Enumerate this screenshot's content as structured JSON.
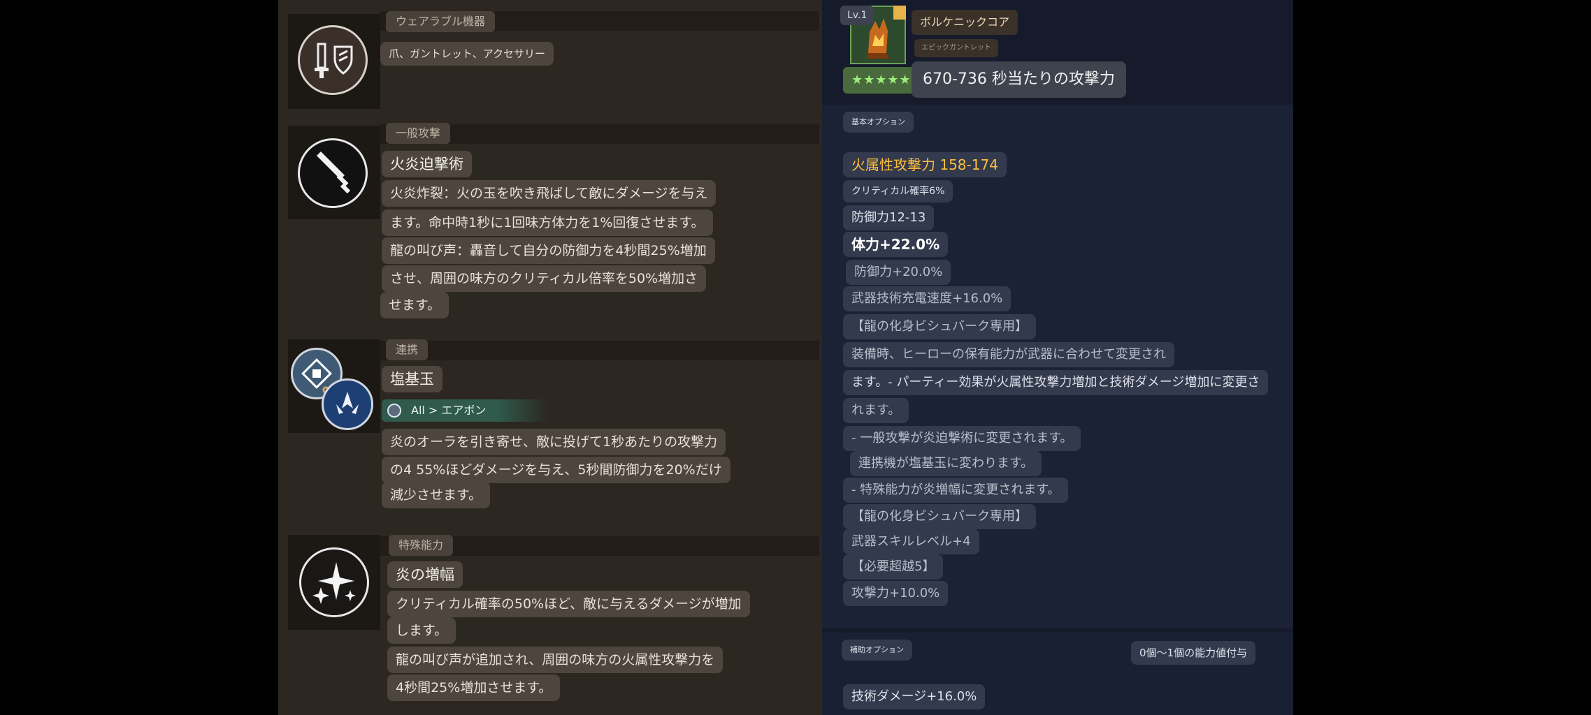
{
  "left": {
    "wearable": {
      "category": "ウェアラブル機器",
      "items": "爪、ガントレット、アクセサリー",
      "icon": "sword-shield-icon"
    },
    "normal_attack": {
      "category": "一般攻撃",
      "name": "火炎迫撃術",
      "icon": "dagger-icon",
      "desc_lines": [
        "火炎炸裂：火の玉を吹き飛ばして敵にダメージを与え",
        "ます。命中時1秒に1回味方体力を1%回復させます。",
        "龍の叫び声：轟音して自分の防御力を4秒間25%増加",
        "させ、周囲の味方のクリティカル倍率を50%増加さ",
        "せます。"
      ]
    },
    "chain": {
      "category": "連携",
      "name": "塩基玉",
      "tag": "All > エアボン",
      "icons": [
        "chain-rune-icon",
        "link-icon",
        "air-emblem-icon"
      ],
      "desc_lines": [
        "炎のオーラを引き寄せ、敵に投げて1秒あたりの攻撃力",
        "の4 55%ほどダメージを与え、5秒間防御力を20%だけ",
        "減少させます。"
      ]
    },
    "special": {
      "category": "特殊能力",
      "name": "炎の増幅",
      "icon": "sparkle-icon",
      "desc_lines": [
        "クリティカル確率の50%ほど、敵に与えるダメージが増加",
        "します。",
        "龍の叫び声が追加され、周囲の味方の火属性攻撃力を",
        "4秒間25%増加させます。"
      ]
    }
  },
  "right": {
    "item": {
      "level": "Lv.1",
      "name": "ボルケニックコア",
      "subtitle": "エピックガントレット",
      "stars": "★★★★★",
      "attack": "670-736 秒当たりの攻撃力",
      "icon": "volcanic-core-gauntlet-icon"
    },
    "base_options": {
      "header": "基本オプション",
      "lines": [
        {
          "text": "火属性攻撃力 158-174",
          "style": "gold"
        },
        {
          "text": "クリティカル確率6%",
          "style": "tiny"
        },
        {
          "text": "防御力12-13",
          "style": ""
        },
        {
          "text": "体力+22.0%",
          "style": "bold"
        },
        {
          "text": "防御力+20.0%",
          "style": "dim"
        },
        {
          "text": "武器技術充電速度+16.0%",
          "style": "dim"
        },
        {
          "text": "【龍の化身ビシュバーク専用】",
          "style": "dim"
        },
        {
          "text": "装備時、ヒーローの保有能力が武器に合わせて変更され",
          "style": "dim"
        },
        {
          "text": "ます。- パーティー効果が火属性攻撃力増加と技術ダメージ増加に変更さ",
          "style": ""
        },
        {
          "text": "れます。",
          "style": "dim"
        },
        {
          "text": "- 一般攻撃が炎迫撃術に変更されます。",
          "style": "dim"
        },
        {
          "text": "連携機が塩基玉に変わります。",
          "style": "dim"
        },
        {
          "text": "- 特殊能力が炎増幅に変更されます。",
          "style": "dim"
        },
        {
          "text": "【龍の化身ビシュバーク専用】",
          "style": "dim"
        },
        {
          "text": "武器スキルレベル+4",
          "style": "dim"
        },
        {
          "text": "【必要超越5】",
          "style": "dim"
        },
        {
          "text": "攻撃力+10.0%",
          "style": "dim"
        }
      ]
    },
    "sub_options": {
      "header": "補助オプション",
      "grant": "0個〜1個の能力値付与",
      "lines": [
        "技術ダメージ+16.0%"
      ]
    }
  }
}
